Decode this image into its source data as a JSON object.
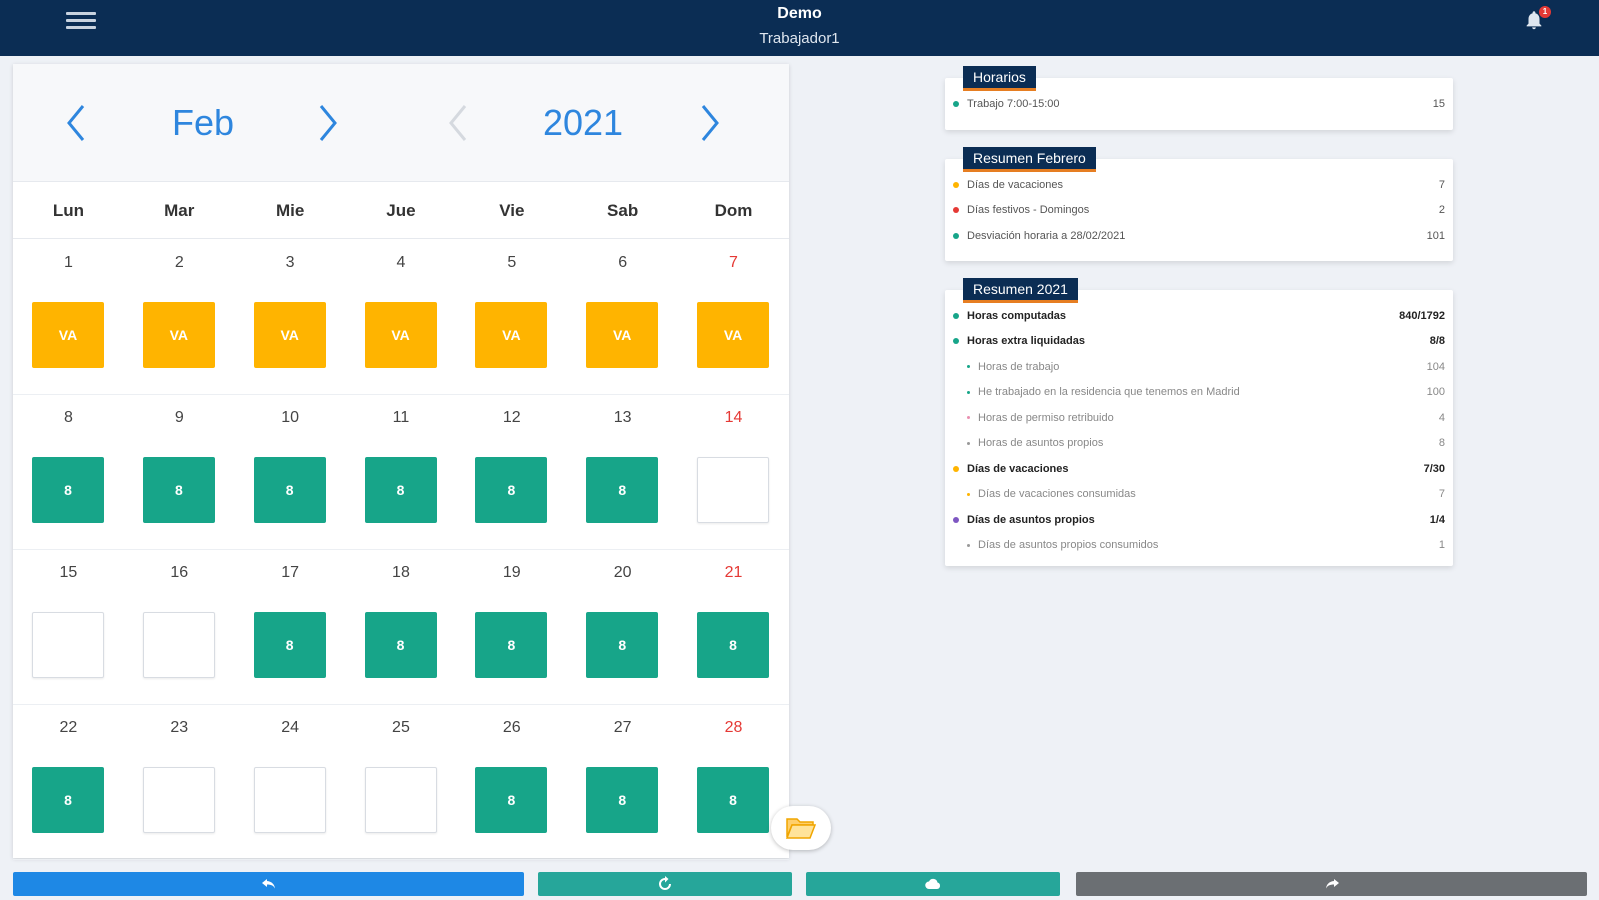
{
  "header": {
    "title": "Demo",
    "subtitle": "Trabajador1",
    "notification_count": "1"
  },
  "calendar": {
    "month": "Feb",
    "year": "2021",
    "weekdays": [
      "Lun",
      "Mar",
      "Mie",
      "Jue",
      "Vie",
      "Sab",
      "Dom"
    ],
    "weeks": [
      [
        {
          "day": "1",
          "status": "va",
          "label": "VA"
        },
        {
          "day": "2",
          "status": "va",
          "label": "VA"
        },
        {
          "day": "3",
          "status": "va",
          "label": "VA"
        },
        {
          "day": "4",
          "status": "va",
          "label": "VA"
        },
        {
          "day": "5",
          "status": "va",
          "label": "VA"
        },
        {
          "day": "6",
          "status": "va",
          "label": "VA"
        },
        {
          "day": "7",
          "status": "va",
          "label": "VA",
          "sunday": true
        }
      ],
      [
        {
          "day": "8",
          "status": "work",
          "label": "8"
        },
        {
          "day": "9",
          "status": "work",
          "label": "8"
        },
        {
          "day": "10",
          "status": "work",
          "label": "8"
        },
        {
          "day": "11",
          "status": "work",
          "label": "8"
        },
        {
          "day": "12",
          "status": "work",
          "label": "8"
        },
        {
          "day": "13",
          "status": "work",
          "label": "8"
        },
        {
          "day": "14",
          "status": "empty",
          "label": "",
          "sunday": true
        }
      ],
      [
        {
          "day": "15",
          "status": "empty",
          "label": ""
        },
        {
          "day": "16",
          "status": "empty",
          "label": ""
        },
        {
          "day": "17",
          "status": "work",
          "label": "8"
        },
        {
          "day": "18",
          "status": "work",
          "label": "8"
        },
        {
          "day": "19",
          "status": "work",
          "label": "8"
        },
        {
          "day": "20",
          "status": "work",
          "label": "8"
        },
        {
          "day": "21",
          "status": "work",
          "label": "8",
          "sunday": true
        }
      ],
      [
        {
          "day": "22",
          "status": "work",
          "label": "8"
        },
        {
          "day": "23",
          "status": "empty",
          "label": ""
        },
        {
          "day": "24",
          "status": "empty",
          "label": ""
        },
        {
          "day": "25",
          "status": "empty",
          "label": ""
        },
        {
          "day": "26",
          "status": "work",
          "label": "8"
        },
        {
          "day": "27",
          "status": "work",
          "label": "8"
        },
        {
          "day": "28",
          "status": "work",
          "label": "8",
          "sunday": true
        }
      ]
    ]
  },
  "cards": [
    {
      "title": "Horarios",
      "rows": [
        {
          "label": "Trabajo 7:00-15:00",
          "value": "15",
          "color": "#17a589",
          "type": "normal"
        }
      ]
    },
    {
      "title": "Resumen Febrero",
      "rows": [
        {
          "label": "Días de vacaciones",
          "value": "7",
          "color": "#ffb400",
          "type": "normal"
        },
        {
          "label": "Días festivos - Domingos",
          "value": "2",
          "color": "#e53935",
          "type": "normal"
        },
        {
          "label": "Desviación horaria a 28/02/2021",
          "value": "101",
          "color": "#17a589",
          "type": "normal"
        }
      ]
    },
    {
      "title": "Resumen 2021",
      "rows": [
        {
          "label": "Horas computadas",
          "value": "840/1792",
          "color": "#17a589",
          "type": "bold"
        },
        {
          "label": "Horas extra liquidadas",
          "value": "8/8",
          "color": "#17a589",
          "type": "bold"
        },
        {
          "label": "Horas de trabajo",
          "value": "104",
          "color": "#17a589",
          "type": "sub"
        },
        {
          "label": "He trabajado en la residencia que tenemos en Madrid",
          "value": "100",
          "color": "#17a589",
          "type": "sub"
        },
        {
          "label": "Horas de permiso retribuido",
          "value": "4",
          "color": "#e98fb0",
          "type": "sub"
        },
        {
          "label": "Horas de asuntos propios",
          "value": "8",
          "color": "#999999",
          "type": "sub"
        },
        {
          "label": "Días de vacaciones",
          "value": "7/30",
          "color": "#ffb400",
          "type": "bold"
        },
        {
          "label": "Días de vacaciones consumidas",
          "value": "7",
          "color": "#ffb400",
          "type": "sub"
        },
        {
          "label": "Días de asuntos propios",
          "value": "1/4",
          "color": "#7e57c2",
          "type": "bold"
        },
        {
          "label": "Días de asuntos propios consumidos",
          "value": "1",
          "color": "#999999",
          "type": "sub"
        }
      ]
    }
  ],
  "colors": {
    "header_bg": "#0b2d54",
    "accent_blue": "#2e86de",
    "vacation": "#ffb400",
    "work": "#17a589",
    "sunday": "#e53935"
  },
  "icons": {
    "menu": "hamburger-icon",
    "notifications": "bell-icon",
    "folder": "folder-open-icon",
    "back": "undo-arrow-icon",
    "refresh": "refresh-icon",
    "upload": "cloud-upload-icon",
    "forward": "share-arrow-icon"
  }
}
